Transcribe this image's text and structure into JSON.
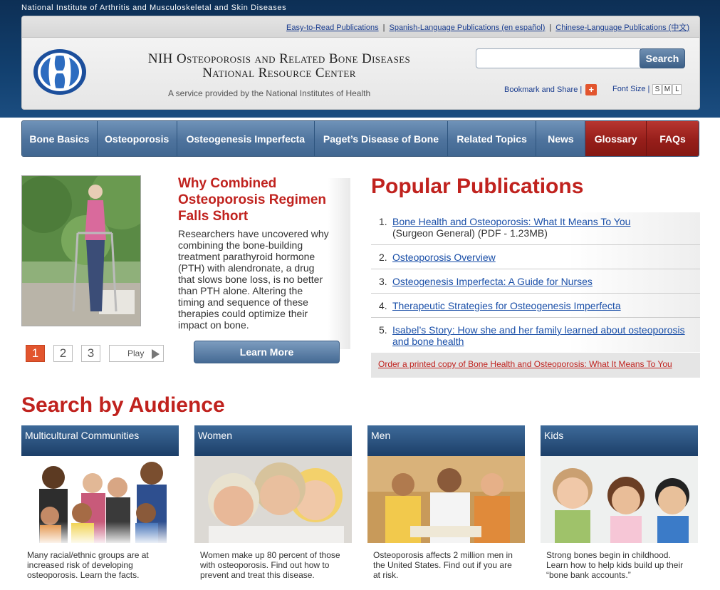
{
  "header": {
    "agency": "National Institute of Arthritis and Musculoskeletal and Skin Diseases",
    "util_links": [
      "Easy-to-Read Publications",
      "Spanish-Language Publications (en español)",
      "Chinese-Language Publications (中文)"
    ],
    "title_line1": "NIH Osteoporosis and Related Bone Diseases",
    "title_line2": "National Resource Center",
    "tagline": "A service provided by the National Institutes of Health",
    "search_placeholder": "",
    "search_button": "Search",
    "bookmark": "Bookmark and Share",
    "bookmark_icon": "+",
    "font_size_label": "Font Size",
    "font_sizes": [
      "S",
      "M",
      "L"
    ]
  },
  "nav": [
    {
      "label": "Bone Basics"
    },
    {
      "label": "Osteoporosis"
    },
    {
      "label": "Osteogenesis Imperfecta"
    },
    {
      "label": "Paget’s Disease of Bone"
    },
    {
      "label": "Related Topics"
    },
    {
      "label": "News"
    },
    {
      "label": "Glossary"
    },
    {
      "label": "FAQs"
    }
  ],
  "feature": {
    "title": "Why Combined Osteoporosis Regimen Falls Short",
    "text": "Researchers have uncovered why combining the bone-building treatment parathyroid hormone (PTH) with alendronate, a drug that slows bone loss, is no better than PTH alone. Altering the timing and sequence of these therapies could optimize their impact on bone.",
    "pager": [
      "1",
      "2",
      "3"
    ],
    "play": "Play",
    "learn_more": "Learn More"
  },
  "popular": {
    "title": "Popular Publications",
    "items": [
      {
        "num": "1.",
        "link": "Bone Health and Osteoporosis: What It Means To You",
        "sub": "(Surgeon General) (PDF - 1.23MB)"
      },
      {
        "num": "2.",
        "link": "Osteoporosis Overview"
      },
      {
        "num": "3.",
        "link": "Osteogenesis Imperfecta: A Guide for Nurses"
      },
      {
        "num": "4.",
        "link": "Therapeutic Strategies for Osteogenesis Imperfecta"
      },
      {
        "num": "5.",
        "link": "Isabel’s Story: How she and her family learned about osteoporosis and bone health"
      }
    ],
    "order": "Order a printed copy of Bone Health and Osteoporosis: What It Means To You"
  },
  "audience": {
    "title": "Search by Audience",
    "cards": [
      {
        "label": "Multicultural Communities",
        "desc": "Many racial/ethnic groups are at increased risk of developing osteoporosis. Learn the facts."
      },
      {
        "label": "Women",
        "desc": "Women make up 80 percent of those with osteoporosis. Find out how to prevent and treat this disease."
      },
      {
        "label": "Men",
        "desc": "Osteoporosis affects 2 million men in the United States. Find out if you are at risk."
      },
      {
        "label": "Kids",
        "desc": "Strong bones begin in childhood. Learn how to help kids build up their “bone bank accounts.”"
      }
    ]
  }
}
